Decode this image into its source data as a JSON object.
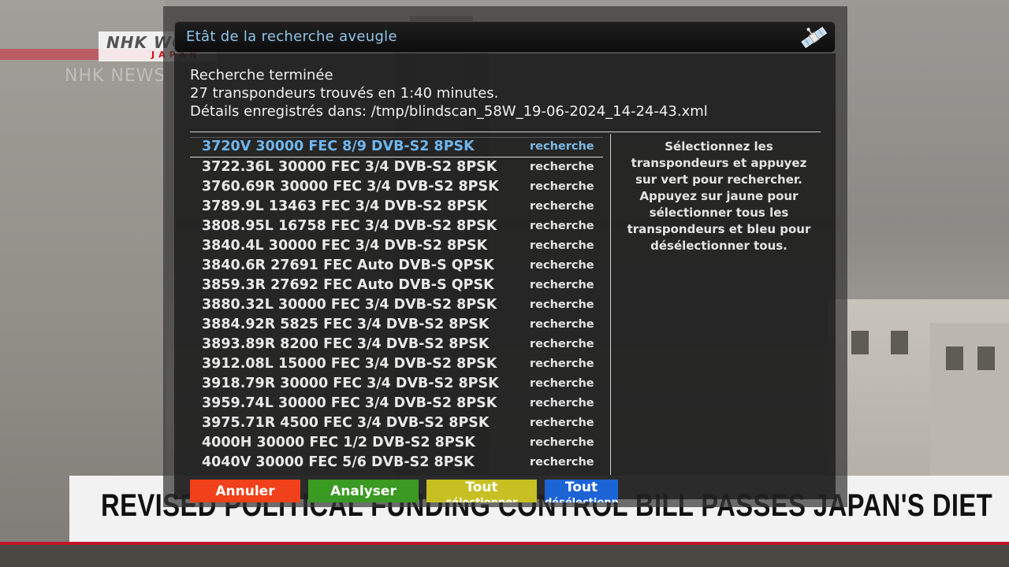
{
  "broadcast": {
    "logo_main": "NHK WORLD",
    "logo_sub": "JAPAN",
    "ghost_text": "NHK NEWS",
    "headline": "REVISED POLITICAL FUNDING CONTROL BILL PASSES JAPAN'S DIET"
  },
  "dialog": {
    "title": "Etât de la recherche aveugle",
    "title_icon": "satellite-icon",
    "status": {
      "line1": "Recherche terminée",
      "line2": "27 transpondeurs trouvés en 1:40 minutes.",
      "line3": "Détails enregistrés dans: /tmp/blindscan_58W_19-06-2024_14-24-43.xml"
    },
    "transponders": [
      {
        "label": "3720V 30000 FEC 8/9 DVB-S2 8PSK",
        "status": "recherche"
      },
      {
        "label": "3722.36L 30000 FEC 3/4 DVB-S2 8PSK",
        "status": "recherche"
      },
      {
        "label": "3760.69R 30000 FEC 3/4 DVB-S2 8PSK",
        "status": "recherche"
      },
      {
        "label": "3789.9L 13463 FEC 3/4 DVB-S2 8PSK",
        "status": "recherche"
      },
      {
        "label": "3808.95L 16758 FEC 3/4 DVB-S2 8PSK",
        "status": "recherche"
      },
      {
        "label": "3840.4L 30000 FEC 3/4 DVB-S2 8PSK",
        "status": "recherche"
      },
      {
        "label": "3840.6R 27691 FEC Auto DVB-S QPSK",
        "status": "recherche"
      },
      {
        "label": "3859.3R 27692 FEC Auto DVB-S QPSK",
        "status": "recherche"
      },
      {
        "label": "3880.32L 30000 FEC 3/4 DVB-S2 8PSK",
        "status": "recherche"
      },
      {
        "label": "3884.92R 5825 FEC 3/4 DVB-S2 8PSK",
        "status": "recherche"
      },
      {
        "label": "3893.89R 8200 FEC 3/4 DVB-S2 8PSK",
        "status": "recherche"
      },
      {
        "label": "3912.08L 15000 FEC 3/4 DVB-S2 8PSK",
        "status": "recherche"
      },
      {
        "label": "3918.79R 30000 FEC 3/4 DVB-S2 8PSK",
        "status": "recherche"
      },
      {
        "label": "3959.74L 30000 FEC 3/4 DVB-S2 8PSK",
        "status": "recherche"
      },
      {
        "label": "3975.71R 4500 FEC 3/4 DVB-S2 8PSK",
        "status": "recherche"
      },
      {
        "label": "4000H 30000 FEC 1/2 DVB-S2 8PSK",
        "status": "recherche"
      },
      {
        "label": "4040V 30000 FEC 5/6 DVB-S2 8PSK",
        "status": "recherche"
      }
    ],
    "selected_index": 0,
    "help_text": "Sélectionnez les transpondeurs et appuyez sur vert pour rechercher. Appuyez sur jaune pour sélectionner tous les transpondeurs et bleu pour désélectionner tous.",
    "buttons": {
      "red": "Annuler",
      "green": "Analyser",
      "yellow_line1": "Tout",
      "yellow_line2": "sélectionner",
      "blue_line1": "Tout",
      "blue_line2": "désélectionner"
    },
    "colors": {
      "title_text": "#8dc6ec",
      "selected_row": "#6fb6ee",
      "red": "#f0411a",
      "green": "#3a9a22",
      "yellow": "#c7c022",
      "blue": "#1c63d6"
    }
  }
}
